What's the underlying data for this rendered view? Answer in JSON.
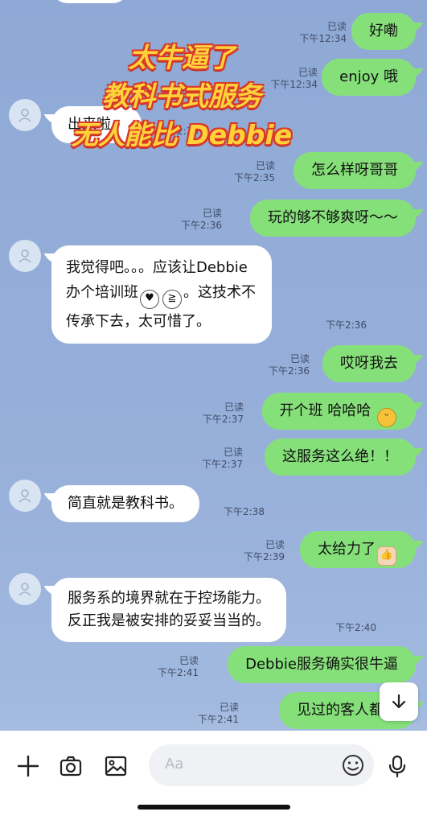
{
  "messages": {
    "m1": {
      "text": "好嘞",
      "read": "已读",
      "time": "下午12:34"
    },
    "m2": {
      "text": "enjoy 哦",
      "read": "已读",
      "time": "下午12:34"
    },
    "m3": {
      "text": "出来啦。",
      "time": "下午2:35"
    },
    "m4": {
      "text": "怎么样呀哥哥",
      "read": "已读",
      "time": "下午2:35"
    },
    "m5": {
      "text": "玩的够不够爽呀～～",
      "read": "已读",
      "time": "下午2:36"
    },
    "m6": {
      "line1": "我觉得吧。。。应该让Debbie",
      "line2a": "办个培训班",
      "line2b": "。这技术不",
      "line3": "传承下去，太可惜了。",
      "time": "下午2:36"
    },
    "m7": {
      "text": "哎呀我去",
      "read": "已读",
      "time": "下午2:36"
    },
    "m8": {
      "text": "开个班 哈哈哈",
      "read": "已读",
      "time": "下午2:37"
    },
    "m9": {
      "text": "这服务这么绝！！",
      "read": "已读",
      "time": "下午2:37"
    },
    "m10": {
      "text": "简直就是教科书。",
      "time": "下午2:38"
    },
    "m11": {
      "text": "太给力了",
      "read": "已读",
      "time": "下午2:39"
    },
    "m12": {
      "line1": "服务系的境界就在于控场能力。",
      "line2": "反正我是被安排的妥妥当当的。",
      "time": "下午2:40"
    },
    "m13": {
      "text": "Debbie服务确实很牛逼",
      "read": "已读",
      "time": "下午2:41"
    },
    "m14": {
      "text": "见过的客人都说",
      "read": "已读",
      "time": "下午2:41"
    }
  },
  "overlay": {
    "line1": "太牛逼了",
    "line2": "教科书式服务",
    "line3": "无人能比 Debbie"
  },
  "input": {
    "placeholder": "Aa"
  },
  "icons": {
    "plus": "plus-icon",
    "camera": "camera-icon",
    "image": "image-icon",
    "emoji": "emoji-icon",
    "mic": "microphone-icon",
    "scroll": "arrow-down-icon"
  },
  "colors": {
    "outgoing": "#86e07a",
    "incoming": "#ffffff",
    "background": "#97b0da"
  }
}
